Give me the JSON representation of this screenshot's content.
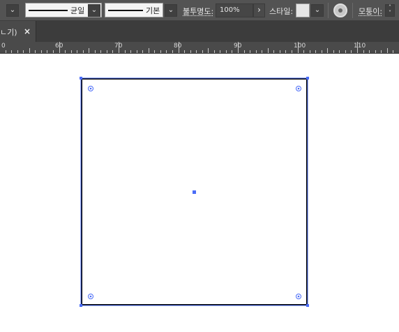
{
  "control_bar": {
    "stroke_cap": {
      "label": "균일"
    },
    "stroke_style": {
      "label": "기본"
    },
    "opacity": {
      "label": "불투명도:",
      "value": "100%"
    },
    "style": {
      "label": "스타일:"
    },
    "transform": {
      "label": "모퉁이:"
    }
  },
  "document_tab": {
    "label": "ㄴ기)",
    "close": "×"
  },
  "ruler": {
    "labels": [
      "0",
      "60",
      "70",
      "80",
      "90",
      "100",
      "110"
    ]
  },
  "colors": {
    "selection": "#4a6cf7",
    "panel": "#535353",
    "artboard": "#ffffff"
  }
}
